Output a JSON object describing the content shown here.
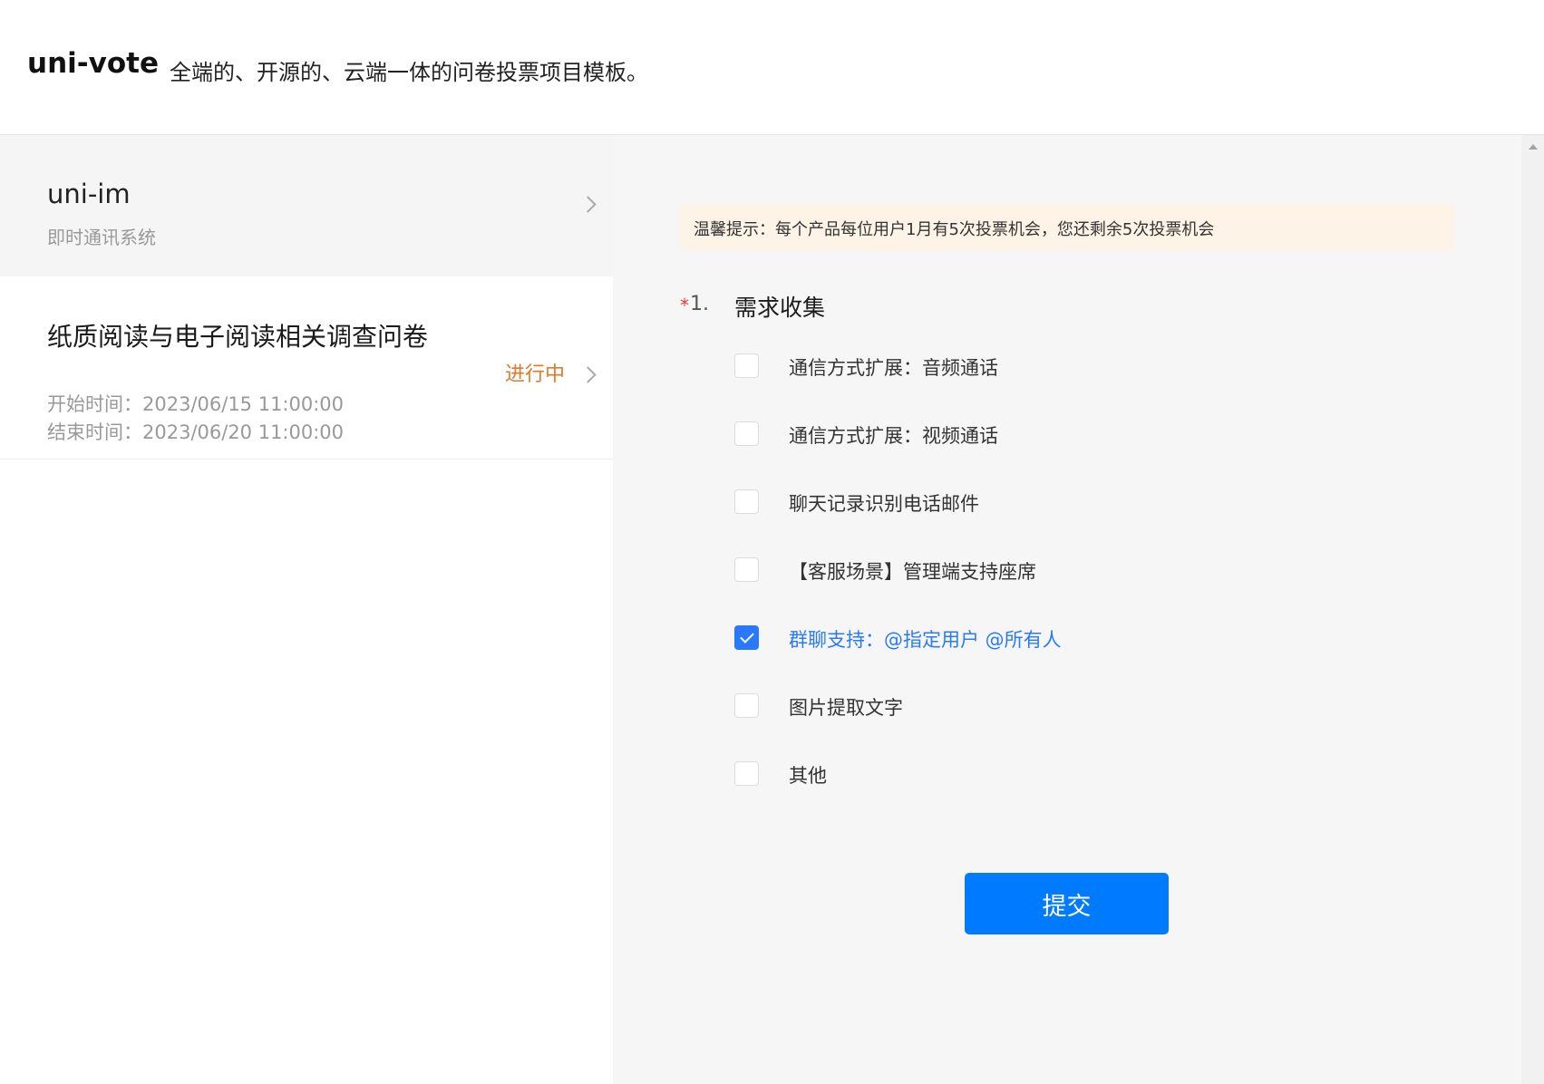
{
  "header": {
    "brand": "uni-vote",
    "tagline": "全端的、开源的、云端一体的问卷投票项目模板。"
  },
  "sidebar": {
    "project": {
      "name": "uni-im",
      "description": "即时通讯系统"
    },
    "survey": {
      "title": "纸质阅读与电子阅读相关调查问卷",
      "start_time": "开始时间：2023/06/15 11:00:00",
      "end_time": "结束时间：2023/06/20 11:00:00",
      "status": "进行中"
    }
  },
  "main": {
    "notice": "温馨提示：每个产品每位用户1月有5次投票机会，您还剩余5次投票机会",
    "question": {
      "required_mark": "*",
      "number": "1.",
      "title": "需求收集",
      "options": [
        {
          "label": "通信方式扩展：音频通话",
          "checked": false
        },
        {
          "label": "通信方式扩展：视频通话",
          "checked": false
        },
        {
          "label": "聊天记录识别电话邮件",
          "checked": false
        },
        {
          "label": "【客服场景】管理端支持座席",
          "checked": false
        },
        {
          "label": "群聊支持：@指定用户 @所有人",
          "checked": true
        },
        {
          "label": "图片提取文字",
          "checked": false
        },
        {
          "label": "其他",
          "checked": false
        }
      ]
    },
    "submit_label": "提交"
  },
  "colors": {
    "accent": "#007aff",
    "checked": "#2979ff",
    "status": "#e07a2c",
    "required": "#e43d33",
    "notice_bg": "#fdf3e7"
  }
}
